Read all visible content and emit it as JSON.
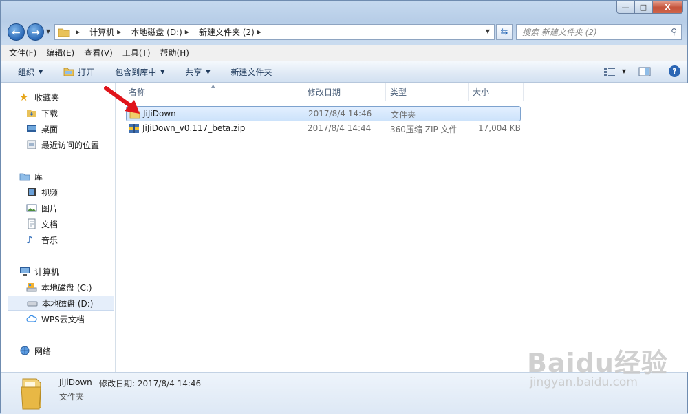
{
  "window": {
    "caption": {
      "minimize": "—",
      "maximize": "□",
      "close": "X"
    }
  },
  "address": {
    "crumbs": [
      "计算机",
      "本地磁盘 (D:)",
      "新建文件夹 (2)"
    ],
    "search_placeholder": "搜索 新建文件夹 (2)"
  },
  "menubar": [
    "文件(F)",
    "编辑(E)",
    "查看(V)",
    "工具(T)",
    "帮助(H)"
  ],
  "toolbar": {
    "organize": "组织",
    "open": "打开",
    "include_library": "包含到库中",
    "share": "共享",
    "new_folder": "新建文件夹",
    "help": "?"
  },
  "sidebar": {
    "favorites": {
      "label": "收藏夹",
      "items": [
        "下载",
        "桌面",
        "最近访问的位置"
      ]
    },
    "libraries": {
      "label": "库",
      "items": [
        "视频",
        "图片",
        "文档",
        "音乐"
      ]
    },
    "computer": {
      "label": "计算机",
      "items": [
        "本地磁盘 (C:)",
        "本地磁盘 (D:)",
        "WPS云文档"
      ]
    },
    "network": {
      "label": "网络"
    }
  },
  "columns": {
    "name": "名称",
    "date": "修改日期",
    "type": "类型",
    "size": "大小"
  },
  "files": [
    {
      "name": "JiJiDown",
      "date": "2017/8/4 14:46",
      "type": "文件夹",
      "size": "",
      "icon": "folder-icon",
      "selected": true
    },
    {
      "name": "JiJiDown_v0.117_beta.zip",
      "date": "2017/8/4 14:44",
      "type": "360压缩 ZIP 文件",
      "size": "17,004 KB",
      "icon": "zip-icon",
      "selected": false
    }
  ],
  "details": {
    "name": "JiJiDown",
    "date_label": "修改日期: 2017/8/4 14:46",
    "type": "文件夹"
  },
  "watermark": {
    "line1": "Baidu经验",
    "line2": "jingyan.baidu.com"
  },
  "colors": {
    "accent": "#2a68b6",
    "selection": "#cde3fb",
    "arrow": "#e0141b"
  }
}
